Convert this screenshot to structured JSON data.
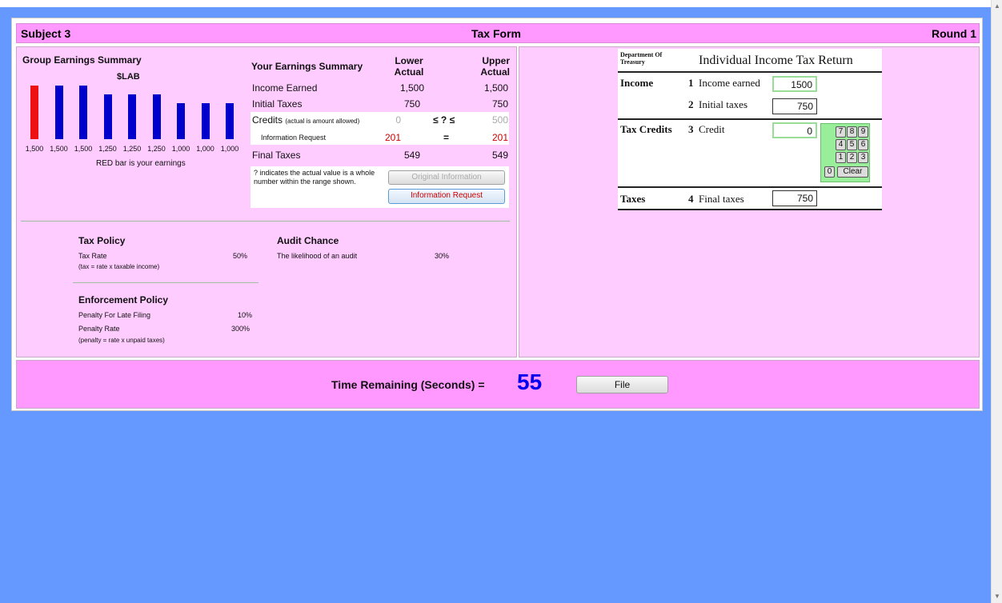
{
  "header": {
    "subject": "Subject 3",
    "title": "Tax Form",
    "round": "Round 1"
  },
  "group_summary": {
    "title": "Group Earnings Summary",
    "unit": "$LAB",
    "legend": "RED bar is your earnings",
    "colors": {
      "own": "#ee1111",
      "others": "#0000cc"
    },
    "chart_data": {
      "type": "bar",
      "categories": [
        "1,500",
        "1,500",
        "1,500",
        "1,250",
        "1,250",
        "1,250",
        "1,000",
        "1,000",
        "1,000"
      ],
      "values": [
        1500,
        1500,
        1500,
        1250,
        1250,
        1250,
        1000,
        1000,
        1000
      ],
      "highlight_index": 0,
      "title": "Group Earnings Summary",
      "ylabel": "$LAB",
      "ylim": [
        0,
        1500
      ]
    }
  },
  "earnings": {
    "title": "Your Earnings Summary",
    "col_lower": "Lower Actual",
    "col_upper": "Upper Actual",
    "rows": [
      {
        "label": "Income Earned",
        "lower": "1,500",
        "upper": "1,500"
      },
      {
        "label": "Initial Taxes",
        "lower": "750",
        "upper": "750"
      }
    ],
    "credits_label": "Credits",
    "credits_note": "(actual is amount allowed)",
    "credits_lower": "0",
    "credits_sym": "≤ ? ≤",
    "credits_upper": "500",
    "inforeq_label": "Information Request",
    "inforeq_lower": "201",
    "inforeq_sym": "=",
    "inforeq_upper": "201",
    "final_label": "Final Taxes",
    "final_lower": "549",
    "final_upper": "549",
    "note": "? indicates the actual value is a whole number within the range shown.",
    "btn_original": "Original Information",
    "btn_request": "Information Request"
  },
  "policy": {
    "tax_title": "Tax Policy",
    "tax_rate_label": "Tax Rate",
    "tax_rate_value": "50%",
    "tax_formula": "(tax = rate x taxable income)",
    "audit_title": "Audit Chance",
    "audit_label": "The likelihood of an audit",
    "audit_value": "30%",
    "enf_title": "Enforcement Policy",
    "late_label": "Penalty For Late Filing",
    "late_value": "10%",
    "penalty_label": "Penalty Rate",
    "penalty_value": "300%",
    "penalty_formula": "(penalty = rate x unpaid taxes)"
  },
  "form": {
    "dept": "Department Of Treasury",
    "title": "Individual Income Tax Return",
    "income_section": "Income",
    "line1_num": "1",
    "line1_label": "Income earned",
    "line1_value": "1500",
    "line2_num": "2",
    "line2_label": "Initial taxes",
    "line2_value": "750",
    "credits_section": "Tax Credits",
    "line3_num": "3",
    "line3_label": "Credit",
    "line3_value": "0",
    "keys": [
      "7",
      "8",
      "9",
      "4",
      "5",
      "6",
      "1",
      "2",
      "3",
      "0"
    ],
    "clear_label": "Clear",
    "taxes_section": "Taxes",
    "line4_num": "4",
    "line4_label": "Final taxes",
    "line4_value": "750"
  },
  "footer": {
    "time_label": "Time Remaining (Seconds) =",
    "time_value": "55",
    "file_label": "File"
  }
}
